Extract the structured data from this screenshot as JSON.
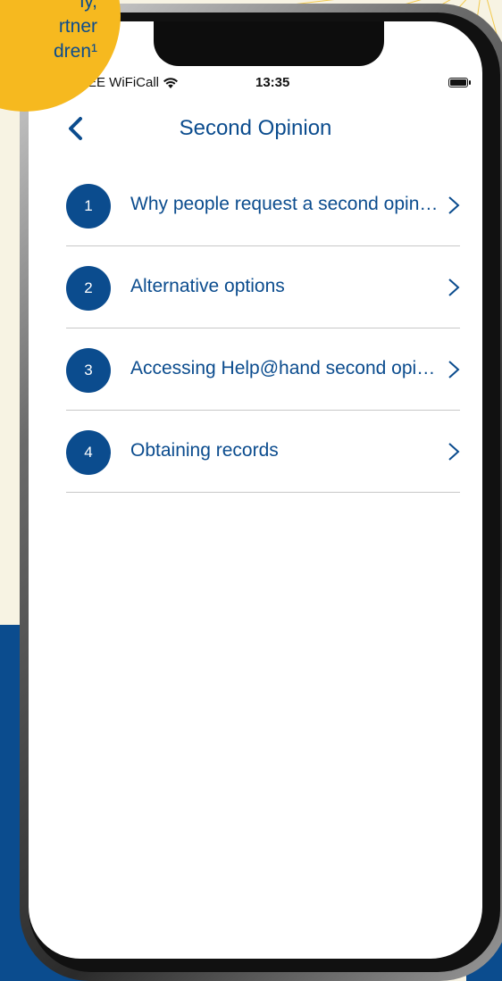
{
  "badge": {
    "lines": [
      "ly,",
      "rtner",
      "dren¹"
    ]
  },
  "status_bar": {
    "carrier": "EE WiFiCall",
    "time": "13:35"
  },
  "nav": {
    "title": "Second Opinion"
  },
  "list": [
    {
      "number": "1",
      "label": "Why people request a second opinion"
    },
    {
      "number": "2",
      "label": "Alternative options"
    },
    {
      "number": "3",
      "label": "Accessing Help@hand second opinion"
    },
    {
      "number": "4",
      "label": "Obtaining records"
    }
  ],
  "colors": {
    "brand_blue": "#0b4c8e",
    "badge_yellow": "#f6b91f",
    "divider": "#c8c8c8"
  },
  "icons": {
    "back": "chevron-left-icon",
    "row": "chevron-right-icon",
    "wifi": "wifi-icon",
    "battery": "battery-icon",
    "signal": "signal-icon"
  }
}
